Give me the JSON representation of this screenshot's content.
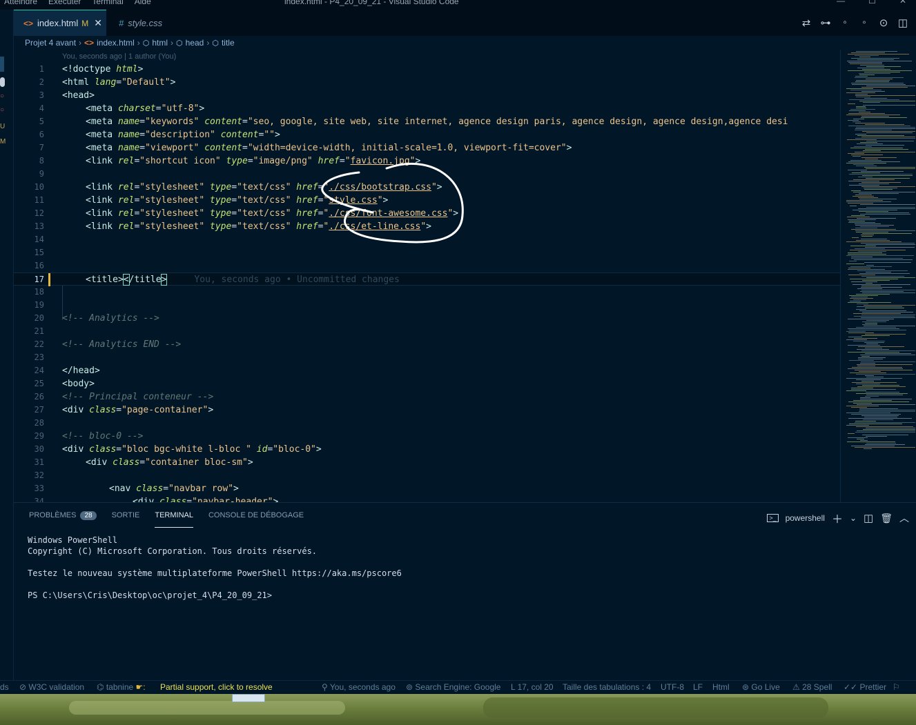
{
  "titlebar": {
    "menu": [
      "Atteindre",
      "Exécuter",
      "Terminal",
      "Aide"
    ],
    "title": "index.html - P4_20_09_21 - Visual Studio Code",
    "controls": [
      "—",
      "☐",
      "✕"
    ]
  },
  "tabs": [
    {
      "label": "index.html",
      "modified": "M",
      "close": "✕",
      "icon": "html-icon"
    },
    {
      "label": "style.css",
      "icon": "css-icon",
      "icon_text": "#"
    }
  ],
  "breadcrumb": [
    "Projet 4 avant",
    "index.html",
    "html",
    "head",
    "title"
  ],
  "blame_top": "You, seconds ago | 1 author (You)",
  "code_lines": [
    {
      "n": "1"
    },
    {
      "n": "2"
    },
    {
      "n": "3"
    },
    {
      "n": "4"
    },
    {
      "n": "5"
    },
    {
      "n": "6"
    },
    {
      "n": "7"
    },
    {
      "n": "8"
    },
    {
      "n": "9"
    },
    {
      "n": "10"
    },
    {
      "n": "11"
    },
    {
      "n": "12"
    },
    {
      "n": "13"
    },
    {
      "n": "14"
    },
    {
      "n": "15"
    },
    {
      "n": "16"
    },
    {
      "n": "17"
    },
    {
      "n": "18"
    },
    {
      "n": "19"
    },
    {
      "n": "20"
    },
    {
      "n": "21"
    },
    {
      "n": "22"
    },
    {
      "n": "23"
    },
    {
      "n": "24"
    },
    {
      "n": "25"
    },
    {
      "n": "26"
    },
    {
      "n": "27"
    },
    {
      "n": "28"
    },
    {
      "n": "29"
    },
    {
      "n": "30"
    },
    {
      "n": "31"
    },
    {
      "n": "32"
    },
    {
      "n": "33"
    },
    {
      "n": "34"
    }
  ],
  "code": {
    "l1_tag": "<!doctype ",
    "l1_attr": "html",
    "l1_end": ">",
    "l2_tag": "<html ",
    "l2_attr": "lang",
    "l2_eq": "=",
    "l2_val": "\"Default\"",
    "l2_end": ">",
    "l3": "<head>",
    "l4_tag": "<meta ",
    "l4_attr": "charset",
    "l4_val": "\"utf-8\"",
    "l4_end": ">",
    "l5_tag": "<meta ",
    "l5_attr1": "name",
    "l5_val1": "\"keywords\"",
    "l5_attr2": "content",
    "l5_val2": "\"seo, google, site web, site internet, agence design paris, agence design, agence design,agence desi",
    "l6_tag": "<meta ",
    "l6_attr1": "name",
    "l6_val1": "\"description\"",
    "l6_attr2": "content",
    "l6_val2": "\"\"",
    "l6_end": ">",
    "l7_tag": "<meta ",
    "l7_attr1": "name",
    "l7_val1": "\"viewport\"",
    "l7_attr2": "content",
    "l7_val2": "\"width=device-width, initial-scale=1.0, viewport-fit=cover\"",
    "l7_end": ">",
    "l8_tag": "<link ",
    "l8_attr1": "rel",
    "l8_val1": "\"shortcut icon\"",
    "l8_attr2": "type",
    "l8_val2": "\"image/png\"",
    "l8_attr3": "href",
    "l8_q1": "\"",
    "l8_file": "favicon.jpg",
    "l8_q2": "\"",
    "l8_end": ">",
    "l10_href": "./css/bootstrap.css",
    "l11_href": "style.css",
    "l12_href": "./css/font-awesome.css",
    "l13_href": "./css/et-line.css",
    "link_tag": "<link ",
    "link_rel": "rel",
    "link_rel_val": "\"stylesheet\"",
    "link_type": "type",
    "link_type_val": "\"text/css\"",
    "link_href": "href",
    "quote": "\"",
    "gt": ">",
    "eq": "=",
    "sp": " ",
    "l17_open": "<title>",
    "l17_close_lt": "<",
    "l17_close_rest": "/title",
    "l17_close_gt": ">",
    "l17_blame": "You, seconds ago • Uncommitted changes",
    "l20": "<!-- Analytics -->",
    "l22": "<!-- Analytics END -->",
    "l24": "</head>",
    "l25": "<body>",
    "l26": "<!-- Principal conteneur -->",
    "l27_tag": "<div ",
    "l27_attr": "class",
    "l27_val": "\"page-container\"",
    "l27_end": ">",
    "l29": "<!-- bloc-0 -->",
    "l30_tag": "<div ",
    "l30_attr1": "class",
    "l30_val1": "\"bloc bgc-white l-bloc \"",
    "l30_attr2": "id",
    "l30_val2": "\"bloc-0\"",
    "l30_end": ">",
    "l31_tag": "<div ",
    "l31_attr": "class",
    "l31_val": "\"container bloc-sm\"",
    "l31_end": ">",
    "l33_tag": "<nav ",
    "l33_attr": "class",
    "l33_val": "\"navbar row\"",
    "l33_end": ">",
    "l34_tag": "<div ",
    "l34_attr": "class",
    "l34_val": "\"navbar-header\"",
    "l34_end": ">"
  },
  "panel": {
    "tabs": [
      {
        "label": "Problèmes",
        "badge": "28"
      },
      {
        "label": "Sortie"
      },
      {
        "label": "Terminal"
      },
      {
        "label": "Console de débogage"
      }
    ],
    "shell": "powershell",
    "terminal_lines": [
      "Windows PowerShell",
      "Copyright (C) Microsoft Corporation. Tous droits réservés.",
      "",
      "Testez le nouveau système multiplateforme PowerShell https://aka.ms/pscore6",
      "",
      "PS C:\\Users\\Cris\\Desktop\\oc\\projet_4\\P4_20_09_21>"
    ]
  },
  "statusbar": {
    "left_cut": "ds",
    "w3c": "W3C validation",
    "tabnine": "tabnine",
    "partial": "Partial support, click to resolve",
    "git": "You, seconds ago",
    "search_engine": "Search Engine: Google",
    "position": "L 17, col 20",
    "tabs": "Taille des tabulations : 4",
    "encoding": "UTF-8",
    "eol": "LF",
    "language": "Html",
    "golive": "Go Live",
    "spell": "28 Spell",
    "prettier": "Prettier"
  },
  "colors": {
    "background": "#011627",
    "tag": "#caece6",
    "attribute": "#c5e478",
    "string": "#ecc48d",
    "comment": "#637777",
    "accent": "#21c7a8"
  }
}
